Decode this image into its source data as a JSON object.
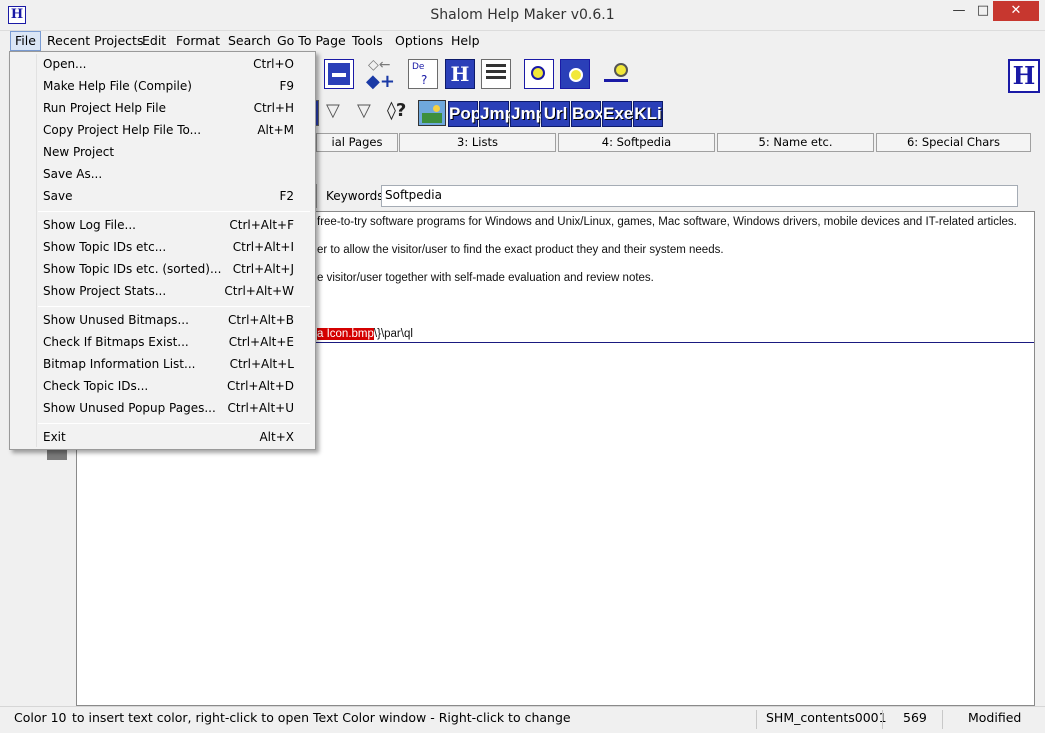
{
  "window": {
    "title": "Shalom Help Maker v0.6.1",
    "icon_letter": "H"
  },
  "menubar": [
    "File",
    "Recent Projects",
    "Edit",
    "Format",
    "Search",
    "Go To Page",
    "Tools",
    "Options",
    "Help"
  ],
  "file_menu": {
    "groups": [
      [
        {
          "label": "Open...",
          "shortcut": "Ctrl+O"
        },
        {
          "label": "Make Help File (Compile)",
          "shortcut": "F9"
        },
        {
          "label": "Run Project Help File",
          "shortcut": "Ctrl+H"
        },
        {
          "label": "Copy Project Help File To...",
          "shortcut": "Alt+M"
        },
        {
          "label": "New Project",
          "shortcut": ""
        },
        {
          "label": "Save As...",
          "shortcut": ""
        },
        {
          "label": "Save",
          "shortcut": "F2"
        }
      ],
      [
        {
          "label": "Show Log File...",
          "shortcut": "Ctrl+Alt+F"
        },
        {
          "label": "Show Topic IDs etc...",
          "shortcut": "Ctrl+Alt+I"
        },
        {
          "label": "Show Topic IDs etc. (sorted)...",
          "shortcut": "Ctrl+Alt+J"
        },
        {
          "label": "Show Project Stats...",
          "shortcut": "Ctrl+Alt+W"
        }
      ],
      [
        {
          "label": "Show Unused Bitmaps...",
          "shortcut": "Ctrl+Alt+B"
        },
        {
          "label": "Check If Bitmaps Exist...",
          "shortcut": "Ctrl+Alt+E"
        },
        {
          "label": "Bitmap Information List...",
          "shortcut": "Ctrl+Alt+L"
        },
        {
          "label": "Check Topic IDs...",
          "shortcut": "Ctrl+Alt+D"
        },
        {
          "label": "Show Unused Popup Pages...",
          "shortcut": "Ctrl+Alt+U"
        }
      ],
      [
        {
          "label": "Exit",
          "shortcut": "Alt+X"
        }
      ]
    ]
  },
  "toolbar_words": [
    "Pop",
    "Jmp",
    "Jmp",
    "Url",
    "Box",
    "Exe",
    "KLi"
  ],
  "tabs": [
    "ial Pages",
    "3: Lists",
    "4: Softpedia",
    "5: Name etc.",
    "6: Special Chars"
  ],
  "keywords": {
    "label": "Keywords:",
    "value": "Softpedia"
  },
  "editor": {
    "line1": "free-to-try software programs for Windows and Unix/Linux, games, Mac software, Windows drivers, mobile devices and IT-related articles.",
    "line2": "er to allow the visitor/user to find the exact product they and their system needs.",
    "line3": "e visitor/user together with self-made evaluation and review notes.",
    "line4_highlight": "a Icon.bmp",
    "line4_tail": "\\}\\par\\ql"
  },
  "status": {
    "color": "Color 10",
    "hint": "to insert text color, right-click to open Text Color window  - Right-click to change",
    "topic": "SHM_contents0001",
    "number": "569",
    "state": "Modified"
  }
}
